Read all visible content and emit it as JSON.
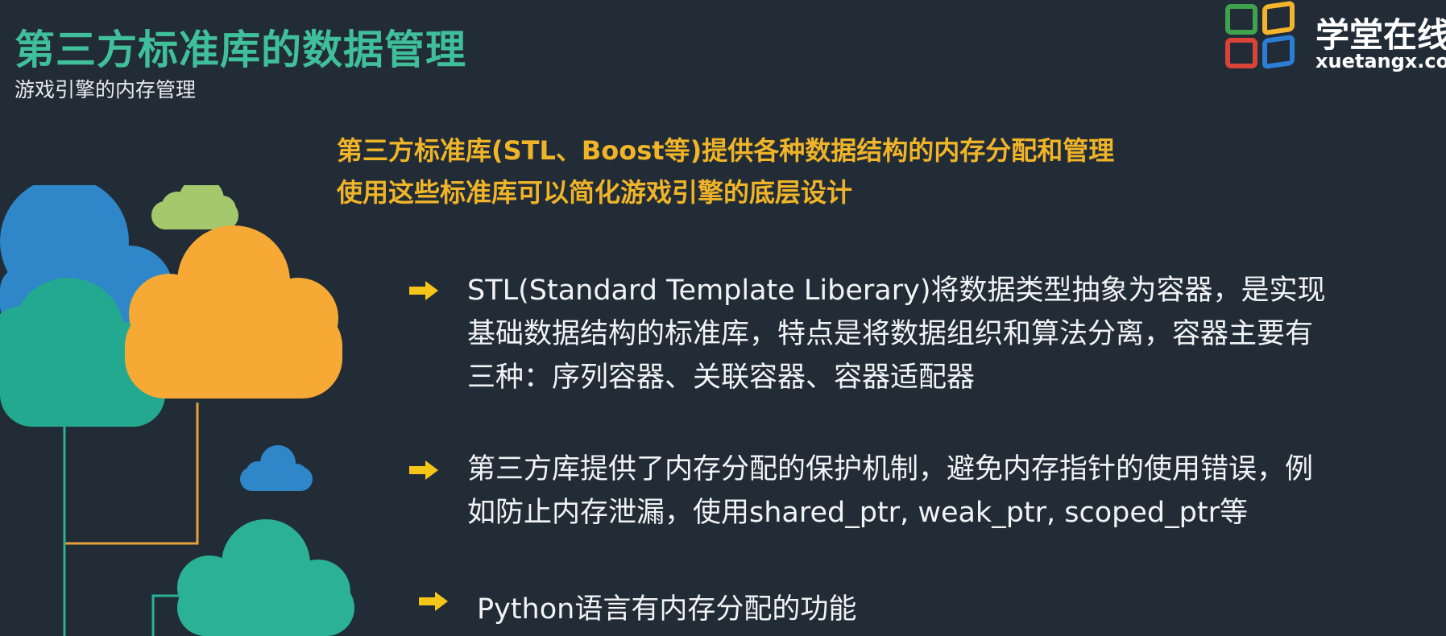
{
  "header": {
    "title": "第三方标准库的数据管理",
    "subtitle": "游戏引擎的内存管理"
  },
  "logo": {
    "name_cn": "学堂在线",
    "name_en": "xuetangx.com",
    "colors": [
      "#3fa34d",
      "#f3b52b",
      "#d9433a",
      "#2a7ed3"
    ]
  },
  "intro": {
    "line1": "第三方标准库(STL、Boost等)提供各种数据结构的内存分配和管理",
    "line2": "使用这些标准库可以简化游戏引擎的底层设计"
  },
  "bullets": [
    {
      "icon": "arrow-right-icon",
      "lines": [
        "STL(Standard Template Liberary)将数据类型抽象为容器，是实现",
        "基础数据结构的标准库，特点是将数据组织和算法分离，容器主要有",
        "三种：序列容器、关联容器、容器适配器"
      ]
    },
    {
      "icon": "arrow-right-icon",
      "lines": [
        "第三方库提供了内存分配的保护机制，避免内存指针的使用错误，例",
        "如防止内存泄漏，使用shared_ptr, weak_ptr, scoped_ptr等"
      ]
    },
    {
      "icon": "arrow-right-icon",
      "lines": [
        "Python语言有内存分配的功能"
      ]
    }
  ],
  "colors": {
    "background": "#222c36",
    "title": "#3fbf9a",
    "intro": "#f0b429",
    "arrow": "#f5c518",
    "text": "#f1f3f5",
    "cloud_blue": "#2f86c9",
    "cloud_green": "#23a98f",
    "cloud_orange": "#f6a935",
    "cloud_lime": "#a3c96c",
    "cloud_teal": "#2bb196"
  }
}
